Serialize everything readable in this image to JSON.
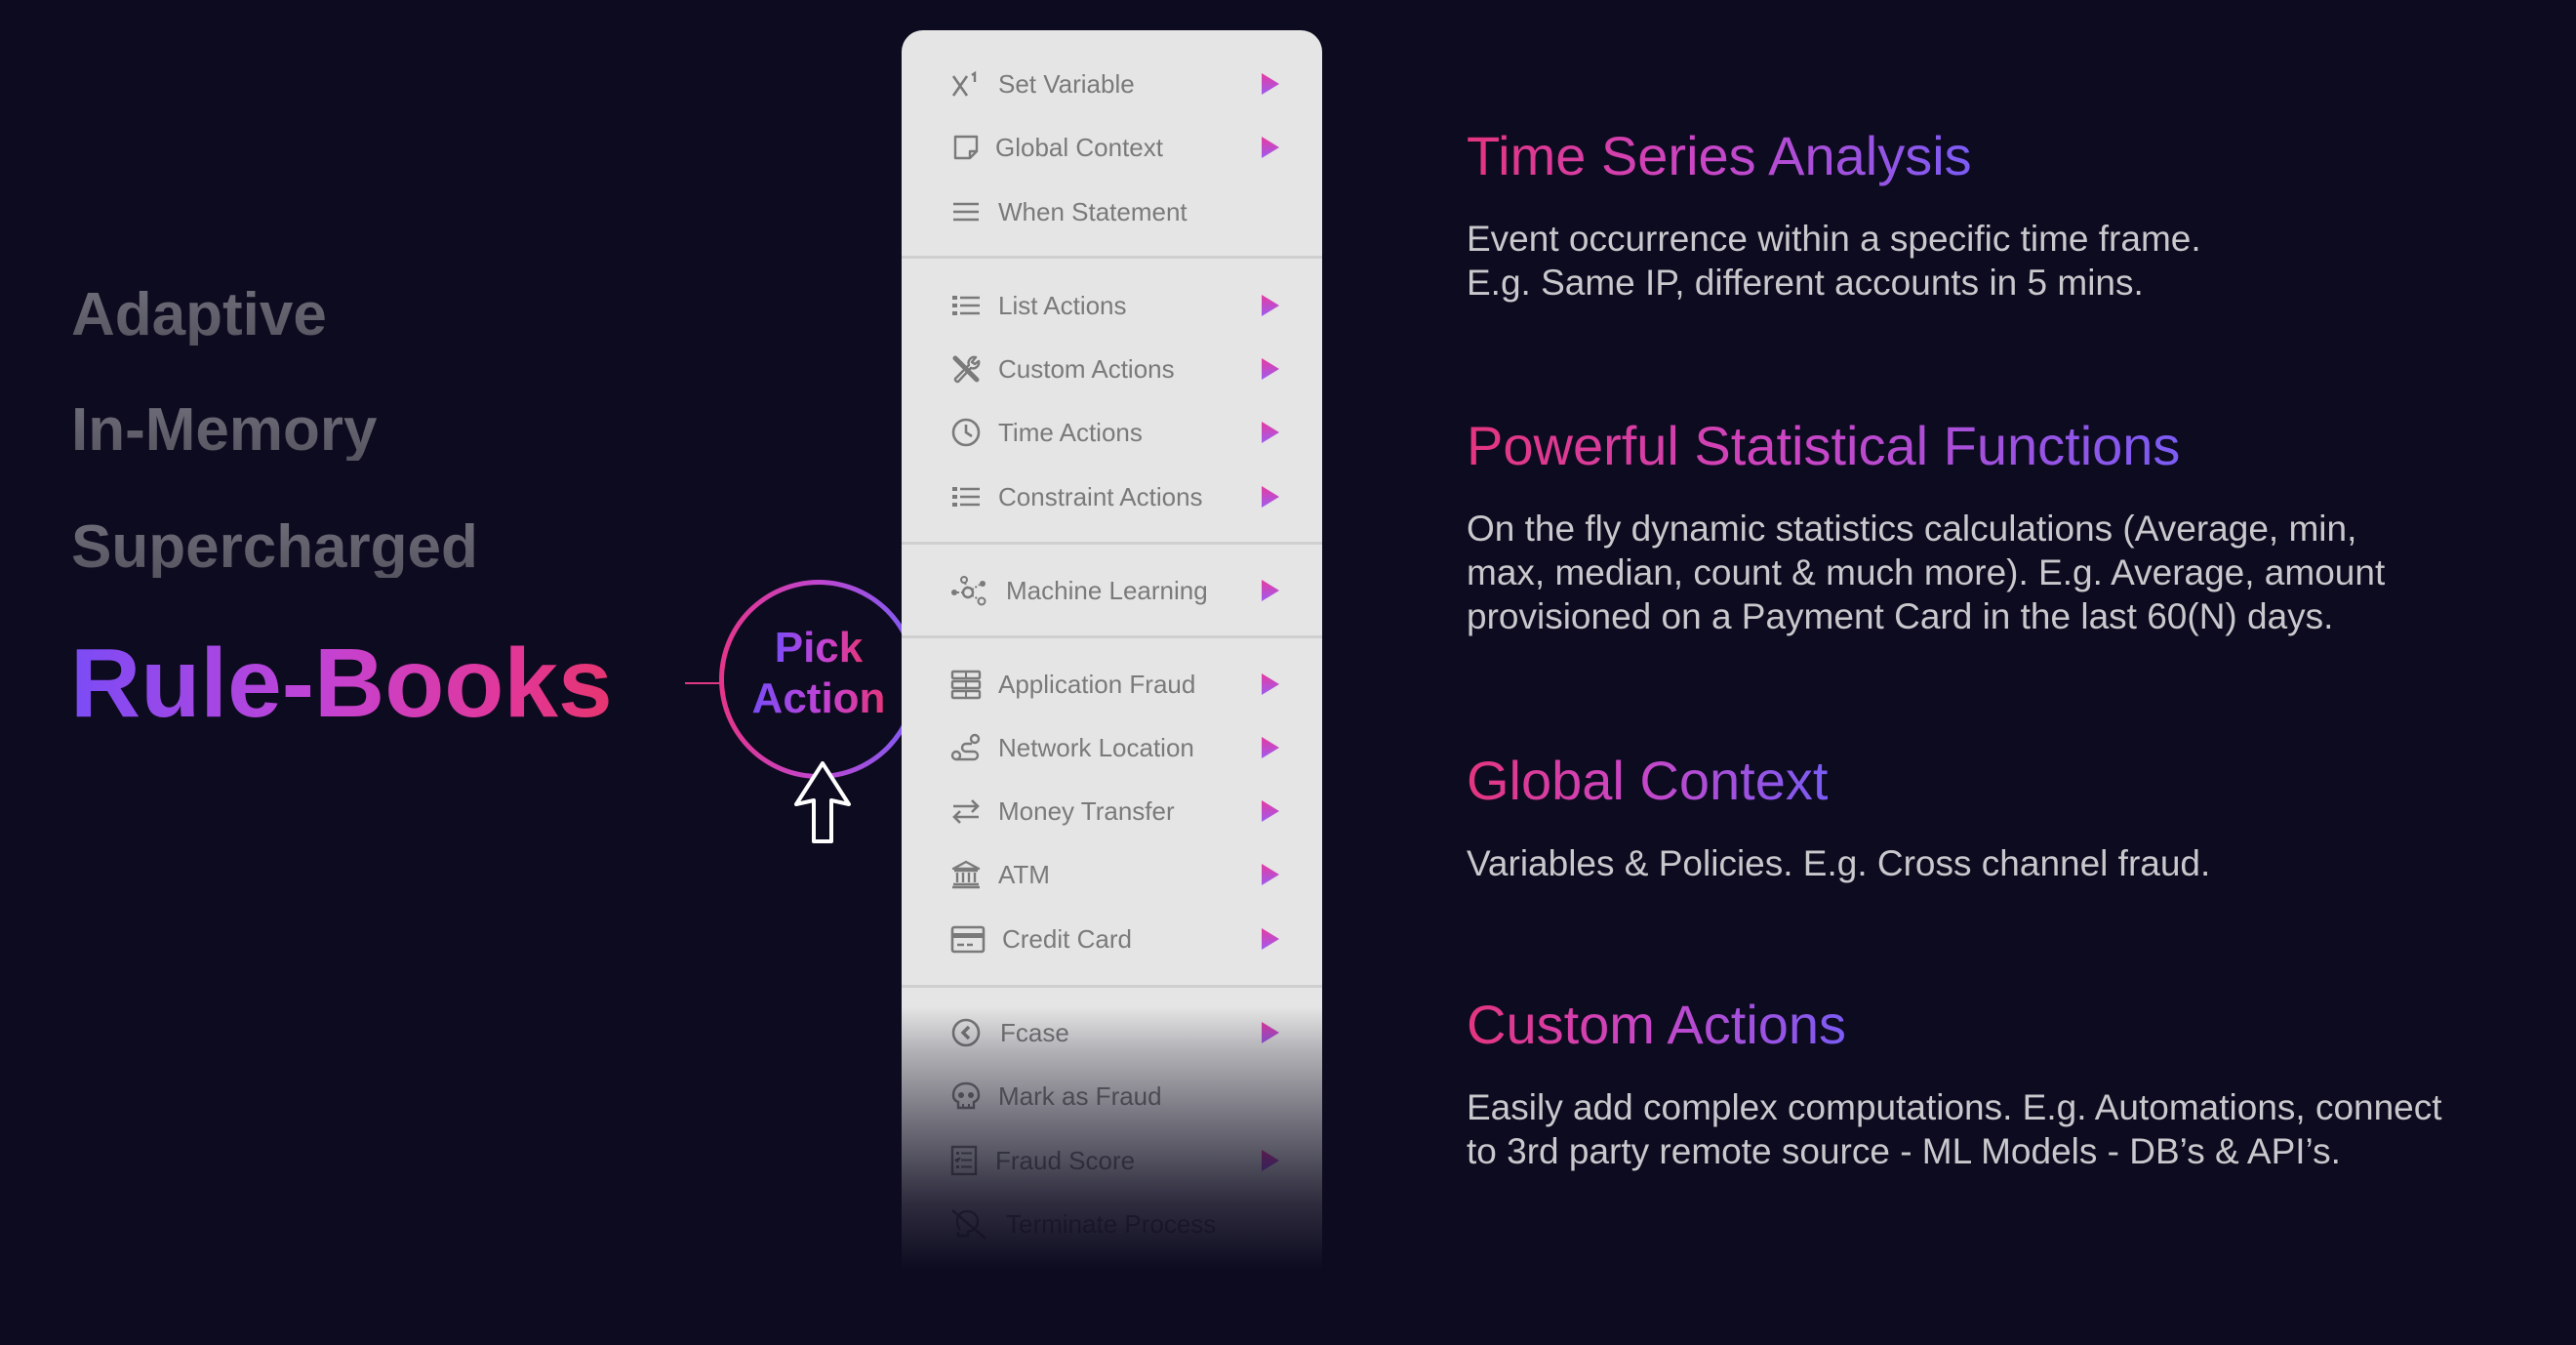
{
  "taglines": [
    "Adaptive",
    "In-Memory",
    "Supercharged"
  ],
  "headline": "Rule-Books",
  "pick_action": {
    "line1": "Pick",
    "line2": "Action"
  },
  "colors": {
    "background": "#0d0b1f",
    "accent_pink": "#e4357f",
    "accent_magenta": "#c847c8",
    "accent_purple": "#7b5cf5",
    "menu_bg": "#e5e5e5",
    "menu_text": "#7a7a7a",
    "muted_text": "#5f5e6b",
    "body_text": "#c9c8cc"
  },
  "menu": {
    "groups": [
      {
        "items": [
          {
            "label": "Set Variable",
            "icon": "superscript-x-icon",
            "has_submenu": true
          },
          {
            "label": "Global Context",
            "icon": "note-icon",
            "has_submenu": true
          },
          {
            "label": "When Statement",
            "icon": "lines-icon",
            "has_submenu": false
          }
        ]
      },
      {
        "items": [
          {
            "label": "List Actions",
            "icon": "list-icon",
            "has_submenu": true
          },
          {
            "label": "Custom Actions",
            "icon": "tools-icon",
            "has_submenu": true
          },
          {
            "label": "Time Actions",
            "icon": "clock-icon",
            "has_submenu": true
          },
          {
            "label": "Constraint Actions",
            "icon": "list-icon",
            "has_submenu": true
          }
        ]
      },
      {
        "items": [
          {
            "label": "Machine Learning",
            "icon": "network-nodes-icon",
            "has_submenu": true
          }
        ]
      },
      {
        "items": [
          {
            "label": "Application Fraud",
            "icon": "stacked-rows-icon",
            "has_submenu": true
          },
          {
            "label": "Network Location",
            "icon": "route-icon",
            "has_submenu": true
          },
          {
            "label": "Money Transfer",
            "icon": "transfer-arrows-icon",
            "has_submenu": true
          },
          {
            "label": "ATM",
            "icon": "bank-icon",
            "has_submenu": true
          },
          {
            "label": "Credit Card",
            "icon": "credit-card-icon",
            "has_submenu": true
          }
        ]
      },
      {
        "items": [
          {
            "label": "Fcase",
            "icon": "circle-back-icon",
            "has_submenu": true
          },
          {
            "label": "Mark as Fraud",
            "icon": "skull-icon",
            "has_submenu": false
          },
          {
            "label": "Fraud Score",
            "icon": "checklist-icon",
            "has_submenu": true
          },
          {
            "label": "Terminate Process",
            "icon": "terminate-icon",
            "has_submenu": false
          }
        ]
      }
    ]
  },
  "features": [
    {
      "title": "Time Series Analysis",
      "lines": [
        "Event occurrence within a specific time frame.",
        "E.g. Same IP, different accounts in 5 mins."
      ]
    },
    {
      "title": "Powerful Statistical Functions",
      "lines": [
        "On the fly dynamic statistics calculations (Average, min,",
        "max, median, count & much more).  E.g. Average, amount",
        "provisioned on a Payment Card in the last 60(N) days."
      ]
    },
    {
      "title": "Global Context",
      "lines": [
        "Variables & Policies. E.g. Cross channel fraud."
      ]
    },
    {
      "title": "Custom Actions",
      "lines": [
        "Easily add complex computations. E.g. Automations, connect",
        "to 3rd party remote source - ML Models - DB’s & API’s."
      ]
    }
  ]
}
